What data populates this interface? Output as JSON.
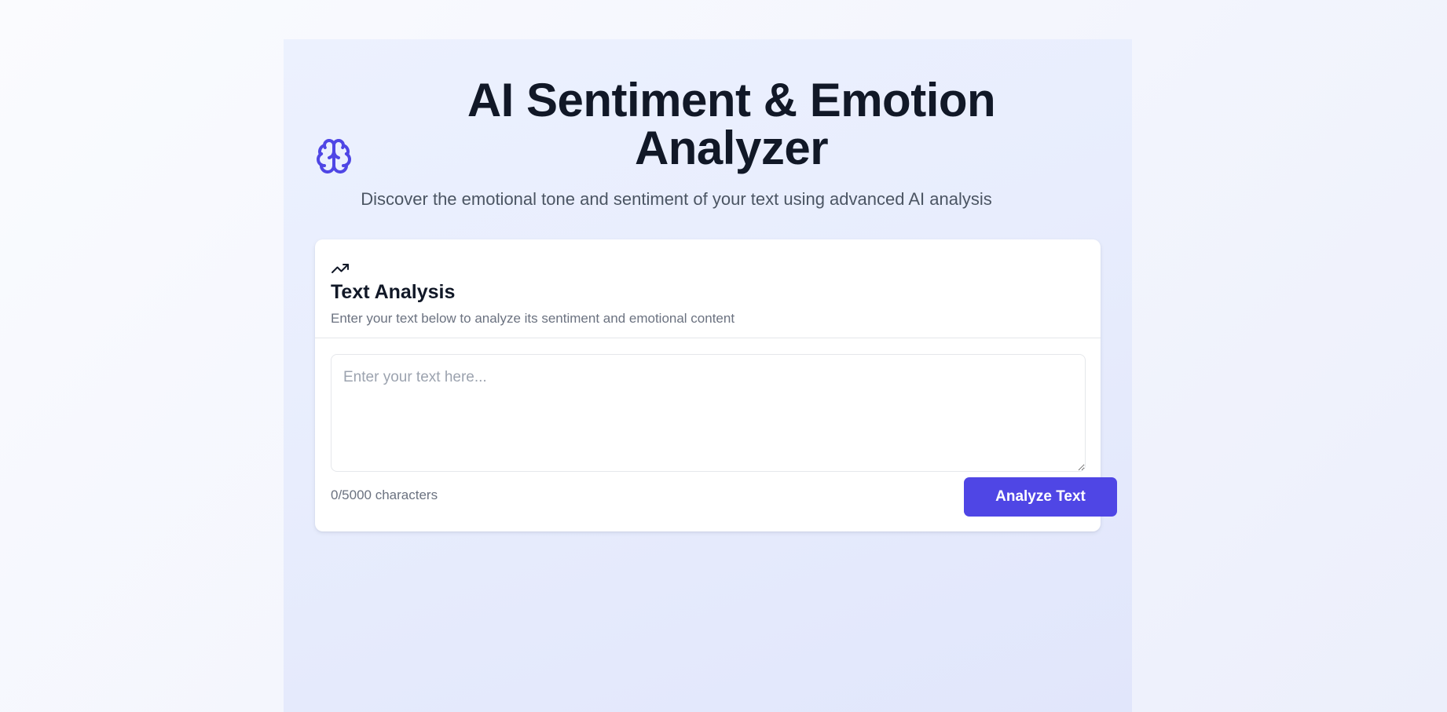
{
  "header": {
    "icon": "brain-icon",
    "title": "AI Sentiment & Emotion Analyzer",
    "subtitle": "Discover the emotional tone and sentiment of your text using advanced AI analysis"
  },
  "card": {
    "icon": "trending-up-icon",
    "title": "Text Analysis",
    "description": "Enter your text below to analyze its sentiment and emotional content",
    "input": {
      "value": "",
      "placeholder": "Enter your text here..."
    },
    "char_count": "0/5000 characters",
    "analyze_label": "Analyze Text"
  },
  "colors": {
    "accent": "#4f46e5",
    "title_text": "#111827",
    "muted_text": "#6b7280",
    "container_bg": "#e8edfd"
  }
}
